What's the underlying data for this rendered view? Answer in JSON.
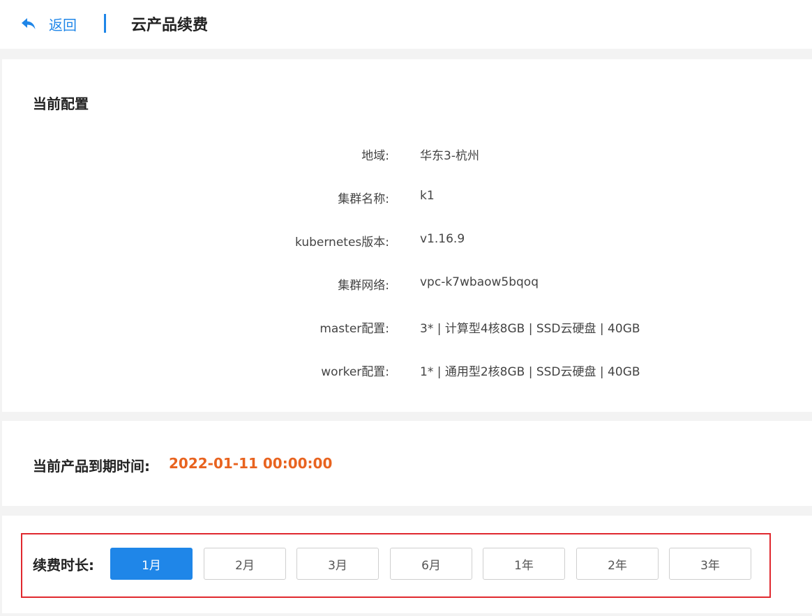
{
  "header": {
    "back_label": "返回",
    "title": "云产品续费"
  },
  "config": {
    "title": "当前配置",
    "rows": [
      {
        "label": "地域:",
        "value": "华东3-杭州"
      },
      {
        "label": "集群名称:",
        "value": "k1"
      },
      {
        "label": "kubernetes版本:",
        "value": "v1.16.9"
      },
      {
        "label": "集群网络:",
        "value": "vpc-k7wbaow5bqoq"
      },
      {
        "label": "master配置:",
        "value": "3* | 计算型4核8GB | SSD云硬盘 | 40GB"
      },
      {
        "label": "worker配置:",
        "value": "1* | 通用型2核8GB | SSD云硬盘 | 40GB"
      }
    ]
  },
  "expiry": {
    "label": "当前产品到期时间:",
    "value": "2022-01-11 00:00:00"
  },
  "renew": {
    "label": "续费时长:",
    "options": [
      "1月",
      "2月",
      "3月",
      "6月",
      "1年",
      "2年",
      "3年"
    ],
    "selected": "1月"
  },
  "colors": {
    "accent": "#1f86e8",
    "expiry": "#e8631f",
    "highlight_border": "#e0282e"
  },
  "icons": {
    "back": "reply-arrow-icon"
  }
}
